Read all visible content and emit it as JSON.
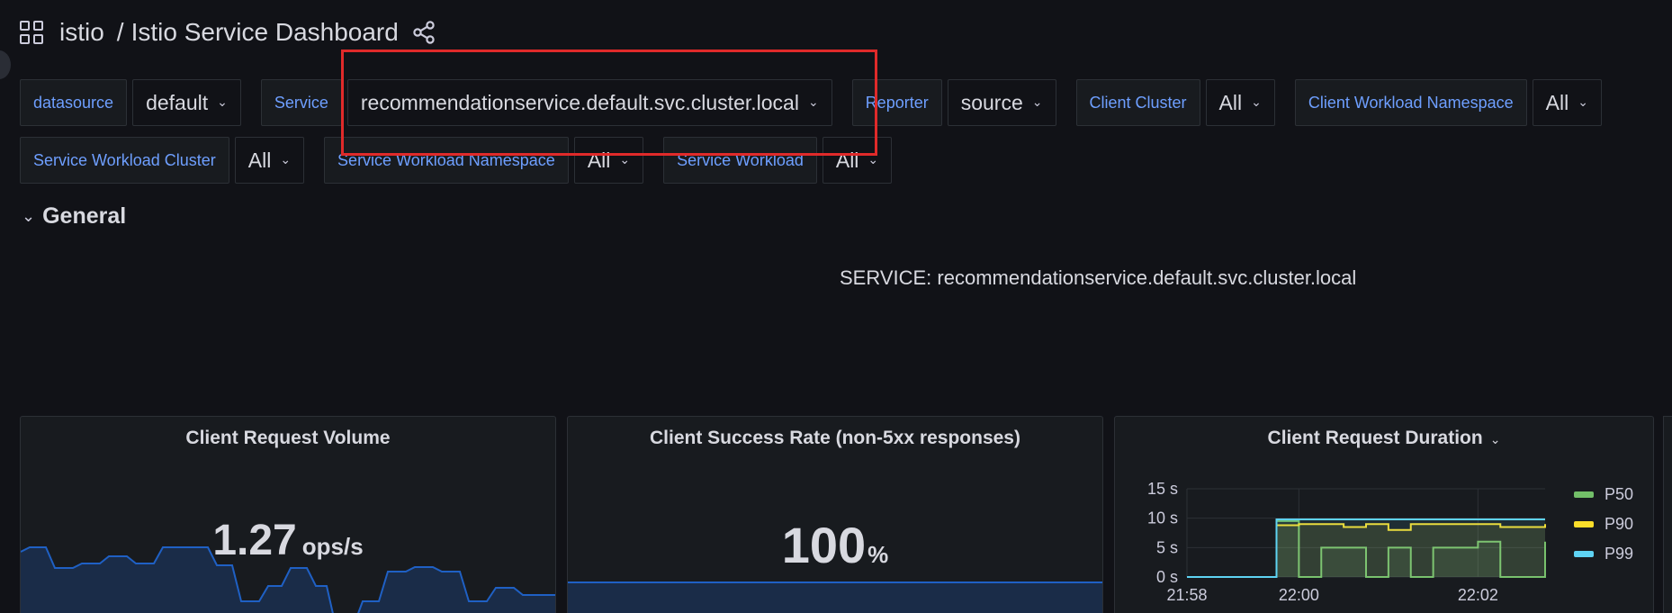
{
  "header": {
    "folder": "istio",
    "separator": "/",
    "title": "Istio Service Dashboard"
  },
  "variables": {
    "row1": [
      {
        "label": "datasource",
        "value": "default"
      },
      {
        "label": "Service",
        "value": "recommendationservice.default.svc.cluster.local"
      },
      {
        "label": "Reporter",
        "value": "source"
      },
      {
        "label": "Client Cluster",
        "value": "All"
      },
      {
        "label": "Client Workload Namespace",
        "value": "All"
      }
    ],
    "row2": [
      {
        "label": "Service Workload Cluster",
        "value": "All"
      },
      {
        "label": "Service Workload Namespace",
        "value": "All"
      },
      {
        "label": "Service Workload",
        "value": "All"
      }
    ]
  },
  "section": {
    "title": "General"
  },
  "service_text": "SERVICE: recommendationservice.default.svc.cluster.local",
  "panels": {
    "volume": {
      "title": "Client Request Volume",
      "value": "1.27",
      "unit": "ops/s"
    },
    "success": {
      "title": "Client Success Rate (non-5xx responses)",
      "value": "100",
      "unit": "%"
    },
    "duration": {
      "title": "Client Request Duration"
    }
  },
  "colors": {
    "background": "#111217",
    "panel": "#181b1f",
    "label_blue": "#6e9fff",
    "highlight": "#e02a2a",
    "p50": "#73bf69",
    "p90": "#fade2a",
    "p99": "#5ed3f3",
    "sparkline": "#1f60c4"
  },
  "chart_data": {
    "type": "line",
    "title": "Client Request Duration",
    "x": [
      "21:58",
      "21:58:30",
      "21:59",
      "21:59:30",
      "21:59:45",
      "22:00",
      "22:00:15",
      "22:00:30",
      "22:00:45",
      "22:01",
      "22:01:15",
      "22:01:30",
      "22:01:45",
      "22:02",
      "22:02:15",
      "22:02:30",
      "22:02:45"
    ],
    "x_ticks": [
      "21:58",
      "22:00",
      "22:02"
    ],
    "y_ticks": [
      "0 s",
      "5 s",
      "10 s",
      "15 s"
    ],
    "ylim": [
      0,
      15
    ],
    "series": [
      {
        "name": "P50",
        "color": "#73bf69",
        "values": [
          0,
          0,
          0,
          0,
          9.5,
          0,
          5,
          5,
          0,
          5,
          0,
          5,
          5,
          6,
          0,
          0,
          6
        ]
      },
      {
        "name": "P90",
        "color": "#fade2a",
        "values": [
          0,
          0,
          0,
          0,
          8.8,
          9,
          9,
          8.5,
          9,
          8,
          9,
          9,
          9,
          9,
          8.5,
          8.5,
          9
        ]
      },
      {
        "name": "P99",
        "color": "#5ed3f3",
        "values": [
          0,
          0,
          0,
          0,
          9.8,
          9.8,
          9.8,
          9.8,
          9.8,
          9.8,
          9.8,
          9.8,
          9.8,
          9.8,
          9.8,
          9.8,
          9.8
        ]
      }
    ],
    "legend": "right",
    "grid": true
  }
}
